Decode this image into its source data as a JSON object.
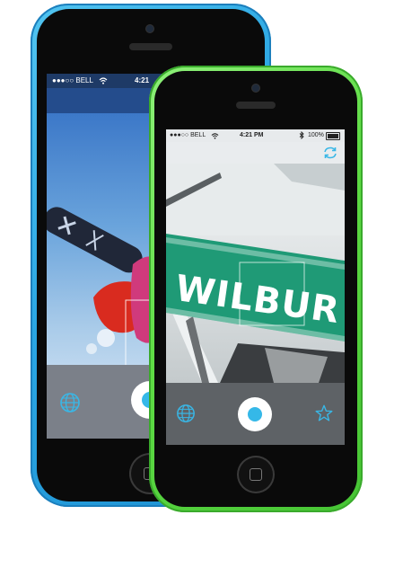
{
  "blue_phone": {
    "status": {
      "carrier": "●●●○○ BELL",
      "time": "4:21"
    }
  },
  "green_phone": {
    "status": {
      "carrier": "●●●○○ BELL",
      "time": "4:21 PM",
      "battery": "100%"
    },
    "sign_text": "WILBUR"
  },
  "icons": {
    "globe": "globe-icon",
    "star": "star-icon",
    "sync": "sync-icon",
    "wifi": "wifi-icon",
    "bluetooth": "bluetooth-icon",
    "battery": "battery-icon"
  },
  "colors": {
    "blue_phone_shell": "#2aa6e3",
    "green_phone_shell": "#5fdc45",
    "accent": "#35b8e8",
    "sign_green": "#1f9a76"
  }
}
